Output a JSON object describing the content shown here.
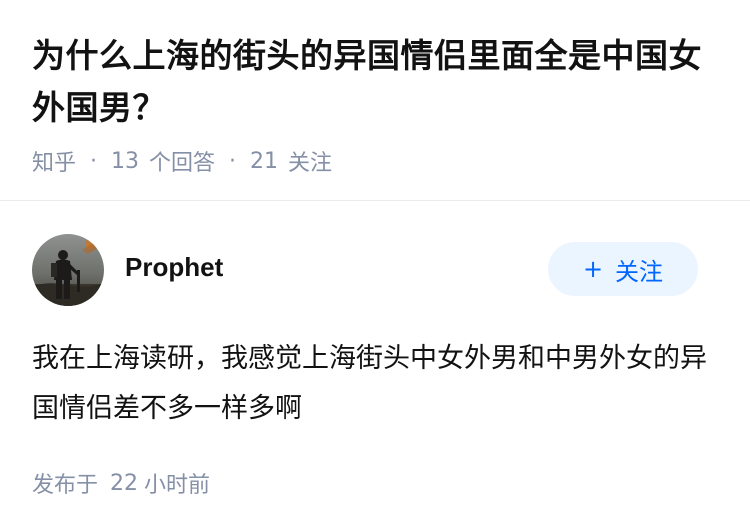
{
  "question": {
    "title": "为什么上海的街头的异国情侣里面全是中国女外国男？",
    "source": "知乎",
    "separator": "·",
    "answer_count": "13",
    "answer_label": "个回答",
    "follower_count": "21",
    "follower_label": "关注"
  },
  "answer": {
    "author": {
      "name": "Prophet",
      "avatar_icon": "avatar-photo-icon"
    },
    "follow_button": {
      "icon": "plus-icon",
      "plus": "+",
      "label": "关注"
    },
    "content": "我在上海读研，我感觉上海街头中女外男和中男外女的异国情侣差不多一样多啊",
    "published": {
      "label": "发布于",
      "number": "22",
      "unit": "小时前"
    }
  },
  "colors": {
    "title": "#121212",
    "meta": "#8590a6",
    "follow_bg": "#ebf5ff",
    "follow_text": "#0066ff",
    "divider": "#ebebeb"
  }
}
